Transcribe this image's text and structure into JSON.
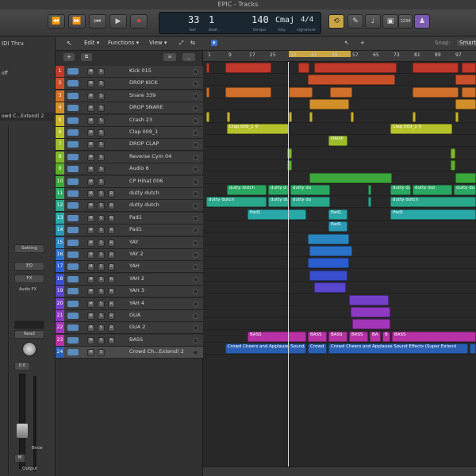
{
  "window": {
    "title": "EPIC - Tracks"
  },
  "transport": {
    "buttons": [
      "⏪",
      "⏩",
      "⏮",
      "▶",
      "⏺"
    ],
    "lcd": {
      "bar": "33",
      "beat": "1",
      "bar_label": "bar",
      "beat_label": "beat",
      "tempo": "140",
      "tempo_label": "tempo",
      "key": "Cmaj",
      "key_label": "key",
      "signature": "4/4",
      "signature_label": "signature"
    },
    "right_buttons": [
      "⟲",
      "✎",
      "♩",
      "▣",
      "1234",
      "♟"
    ]
  },
  "toolbar": {
    "edit": "Edit ▾",
    "functions": "Functions ▾",
    "view": "View ▾",
    "snap_label": "Snap:",
    "snap_value": "Smart"
  },
  "inspector": {
    "top_label": "IDI Thru",
    "rows": [
      "",
      "",
      "off",
      "",
      ""
    ],
    "region_name": "owd C...Extend)  2",
    "setting": "Setting",
    "eq": "EQ",
    "fx": "FX",
    "audio_fx": "Audio FX",
    "read": "Read",
    "volume": "0.0",
    "bnce": "Bnce",
    "m": "M",
    "output": "Output"
  },
  "ruler": {
    "marks": [
      "1",
      "9",
      "17",
      "25",
      "33",
      "41",
      "49",
      "57",
      "65",
      "73",
      "81",
      "89",
      "97"
    ]
  },
  "tracks": [
    {
      "num": "1",
      "name": "Kick 015",
      "color": "#c0392b",
      "r": ""
    },
    {
      "num": "2",
      "name": "DROP KICK",
      "color": "#c9512a",
      "r": ""
    },
    {
      "num": "3",
      "name": "Snare 339",
      "color": "#d0702a",
      "r": ""
    },
    {
      "num": "4",
      "name": "DROP SNARE",
      "color": "#d2902a",
      "r": ""
    },
    {
      "num": "5",
      "name": "Crash 23",
      "color": "#c9b52b",
      "r": ""
    },
    {
      "num": "6",
      "name": "Clap 009_1",
      "color": "#b5c22b",
      "r": ""
    },
    {
      "num": "7",
      "name": "DROP CLAP",
      "color": "#9fbd2b",
      "r": ""
    },
    {
      "num": "8",
      "name": "Reverse Cym 04",
      "color": "#7fb72b",
      "r": ""
    },
    {
      "num": "9",
      "name": "Audio 6",
      "color": "#5eb02b",
      "r": ""
    },
    {
      "num": "10",
      "name": "CP Hihat 006",
      "color": "#3aa83a",
      "r": ""
    },
    {
      "num": "11",
      "name": "dutty dutch",
      "color": "#2aa863",
      "r": "R"
    },
    {
      "num": "12",
      "name": "dutty dutch",
      "color": "#2aa88c",
      "r": "R"
    },
    {
      "num": "13",
      "name": "Pad1",
      "color": "#2aa8a8",
      "r": "R"
    },
    {
      "num": "14",
      "name": "Pad1",
      "color": "#2a9ab5",
      "r": "R"
    },
    {
      "num": "15",
      "name": "YAY",
      "color": "#2a86c0",
      "r": "R"
    },
    {
      "num": "16",
      "name": "YAY 2",
      "color": "#2a72c9",
      "r": "R"
    },
    {
      "num": "17",
      "name": "YAH",
      "color": "#2a5ecf",
      "r": "R"
    },
    {
      "num": "18",
      "name": "YAH 2",
      "color": "#3a4fd0",
      "r": "R"
    },
    {
      "num": "19",
      "name": "YAH 3",
      "color": "#5a45cf",
      "r": "R"
    },
    {
      "num": "20",
      "name": "YAH 4",
      "color": "#7540c9",
      "r": "R"
    },
    {
      "num": "21",
      "name": "GUA",
      "color": "#8d3ac2",
      "r": "R"
    },
    {
      "num": "22",
      "name": "GUA 2",
      "color": "#a236b8",
      "r": "R"
    },
    {
      "num": "23",
      "name": "BASS",
      "color": "#b832a6",
      "r": "R"
    },
    {
      "num": "24",
      "name": "Crowd Ch...Extend)  2",
      "color": "#2a5eb0",
      "r": ""
    }
  ],
  "regions": [
    {
      "lane": 0,
      "start": 4,
      "width": 3,
      "color": "#c0392b",
      "label": ""
    },
    {
      "lane": 0,
      "start": 28,
      "width": 58,
      "color": "#c0392b",
      "label": ""
    },
    {
      "lane": 0,
      "start": 120,
      "width": 14,
      "color": "#c0392b",
      "label": ""
    },
    {
      "lane": 0,
      "start": 140,
      "width": 104,
      "color": "#c0392b",
      "label": ""
    },
    {
      "lane": 0,
      "start": 264,
      "width": 58,
      "color": "#c0392b",
      "label": ""
    },
    {
      "lane": 0,
      "start": 326,
      "width": 18,
      "color": "#c0392b",
      "label": ""
    },
    {
      "lane": 1,
      "start": 132,
      "width": 110,
      "color": "#c9512a",
      "label": ""
    },
    {
      "lane": 1,
      "start": 318,
      "width": 26,
      "color": "#c9512a",
      "label": ""
    },
    {
      "lane": 2,
      "start": 4,
      "width": 3,
      "color": "#d0702a",
      "label": ""
    },
    {
      "lane": 2,
      "start": 28,
      "width": 58,
      "color": "#d0702a",
      "label": ""
    },
    {
      "lane": 2,
      "start": 108,
      "width": 30,
      "color": "#d0702a",
      "label": ""
    },
    {
      "lane": 2,
      "start": 160,
      "width": 28,
      "color": "#d0702a",
      "label": ""
    },
    {
      "lane": 2,
      "start": 264,
      "width": 58,
      "color": "#d0702a",
      "label": ""
    },
    {
      "lane": 2,
      "start": 326,
      "width": 18,
      "color": "#d0702a",
      "label": ""
    },
    {
      "lane": 3,
      "start": 134,
      "width": 50,
      "color": "#d2902a",
      "label": ""
    },
    {
      "lane": 3,
      "start": 318,
      "width": 26,
      "color": "#d2902a",
      "label": ""
    },
    {
      "lane": 4,
      "start": 4,
      "width": 3,
      "color": "#c9b52b",
      "label": ""
    },
    {
      "lane": 4,
      "start": 30,
      "width": 4,
      "color": "#c9b52b",
      "label": ""
    },
    {
      "lane": 4,
      "start": 108,
      "width": 4,
      "color": "#c9b52b",
      "label": ""
    },
    {
      "lane": 4,
      "start": 134,
      "width": 4,
      "color": "#c9b52b",
      "label": ""
    },
    {
      "lane": 4,
      "start": 186,
      "width": 4,
      "color": "#c9b52b",
      "label": ""
    },
    {
      "lane": 4,
      "start": 264,
      "width": 4,
      "color": "#c9b52b",
      "label": ""
    },
    {
      "lane": 4,
      "start": 318,
      "width": 4,
      "color": "#c9b52b",
      "label": ""
    },
    {
      "lane": 5,
      "start": 30,
      "width": 78,
      "color": "#b5c22b",
      "label": "Clap 009_1 ⚲"
    },
    {
      "lane": 5,
      "start": 236,
      "width": 78,
      "color": "#b5c22b",
      "label": "Clap 009_1 ⚲"
    },
    {
      "lane": 6,
      "start": 158,
      "width": 24,
      "color": "#9fbd2b",
      "label": "DROP"
    },
    {
      "lane": 7,
      "start": 106,
      "width": 6,
      "color": "#7fb72b",
      "label": ""
    },
    {
      "lane": 7,
      "start": 312,
      "width": 6,
      "color": "#7fb72b",
      "label": ""
    },
    {
      "lane": 8,
      "start": 106,
      "width": 6,
      "color": "#5eb02b",
      "label": ""
    },
    {
      "lane": 8,
      "start": 312,
      "width": 6,
      "color": "#5eb02b",
      "label": ""
    },
    {
      "lane": 9,
      "start": 134,
      "width": 104,
      "color": "#3aa83a",
      "label": ""
    },
    {
      "lane": 9,
      "start": 318,
      "width": 26,
      "color": "#3aa83a",
      "label": ""
    },
    {
      "lane": 10,
      "start": 30,
      "width": 50,
      "color": "#2aa863",
      "label": "dutty dutch"
    },
    {
      "lane": 10,
      "start": 82,
      "width": 26,
      "color": "#2aa863",
      "label": "dutty d"
    },
    {
      "lane": 10,
      "start": 110,
      "width": 50,
      "color": "#2aa863",
      "label": "dutty du"
    },
    {
      "lane": 10,
      "start": 208,
      "width": 4,
      "color": "#2aa863",
      "label": ""
    },
    {
      "lane": 10,
      "start": 236,
      "width": 26,
      "color": "#2aa863",
      "label": "dutty du"
    },
    {
      "lane": 10,
      "start": 264,
      "width": 50,
      "color": "#2aa863",
      "label": "dutty dut"
    },
    {
      "lane": 10,
      "start": 316,
      "width": 28,
      "color": "#2aa863",
      "label": "dutty du"
    },
    {
      "lane": 11,
      "start": 4,
      "width": 76,
      "color": "#2aa88c",
      "label": "dutty dutch"
    },
    {
      "lane": 11,
      "start": 82,
      "width": 26,
      "color": "#2aa88c",
      "label": "dutty du"
    },
    {
      "lane": 11,
      "start": 110,
      "width": 50,
      "color": "#2aa88c",
      "label": "dutty du"
    },
    {
      "lane": 11,
      "start": 208,
      "width": 4,
      "color": "#2aa88c",
      "label": ""
    },
    {
      "lane": 11,
      "start": 236,
      "width": 108,
      "color": "#2aa88c",
      "label": "dutty dutch"
    },
    {
      "lane": 12,
      "start": 56,
      "width": 74,
      "color": "#2aa8a8",
      "label": "Pad1"
    },
    {
      "lane": 12,
      "start": 158,
      "width": 24,
      "color": "#2aa8a8",
      "label": "Pad1"
    },
    {
      "lane": 12,
      "start": 236,
      "width": 108,
      "color": "#2aa8a8",
      "label": "Pad1"
    },
    {
      "lane": 13,
      "start": 158,
      "width": 24,
      "color": "#2a9ab5",
      "label": "Pad1"
    },
    {
      "lane": 14,
      "start": 132,
      "width": 52,
      "color": "#2a86c0",
      "label": ""
    },
    {
      "lane": 15,
      "start": 134,
      "width": 54,
      "color": "#2a72c9",
      "label": ""
    },
    {
      "lane": 16,
      "start": 132,
      "width": 52,
      "color": "#2a5ecf",
      "label": ""
    },
    {
      "lane": 17,
      "start": 134,
      "width": 48,
      "color": "#3a4fd0",
      "label": ""
    },
    {
      "lane": 18,
      "start": 140,
      "width": 40,
      "color": "#5a45cf",
      "label": ""
    },
    {
      "lane": 19,
      "start": 184,
      "width": 50,
      "color": "#7540c9",
      "label": ""
    },
    {
      "lane": 20,
      "start": 186,
      "width": 50,
      "color": "#8d3ac2",
      "label": ""
    },
    {
      "lane": 21,
      "start": 188,
      "width": 48,
      "color": "#a236b8",
      "label": ""
    },
    {
      "lane": 22,
      "start": 56,
      "width": 74,
      "color": "#b832a6",
      "label": "BASS"
    },
    {
      "lane": 22,
      "start": 132,
      "width": 24,
      "color": "#b832a6",
      "label": "BASS"
    },
    {
      "lane": 22,
      "start": 158,
      "width": 24,
      "color": "#b832a6",
      "label": "BASS"
    },
    {
      "lane": 22,
      "start": 184,
      "width": 24,
      "color": "#b832a6",
      "label": "BASS"
    },
    {
      "lane": 22,
      "start": 210,
      "width": 14,
      "color": "#b832a6",
      "label": "BA"
    },
    {
      "lane": 22,
      "start": 226,
      "width": 10,
      "color": "#b832a6",
      "label": "B"
    },
    {
      "lane": 22,
      "start": 238,
      "width": 106,
      "color": "#b832a6",
      "label": "BASS"
    },
    {
      "lane": 23,
      "start": 28,
      "width": 102,
      "color": "#2a5eb0",
      "label": "Crowd Cheers and Applause Sound"
    },
    {
      "lane": 23,
      "start": 132,
      "width": 24,
      "color": "#2a5eb0",
      "label": "Crowd"
    },
    {
      "lane": 23,
      "start": 158,
      "width": 176,
      "color": "#2a5eb0",
      "label": "Crowd Cheers and Applause Sound Effects (Super Extend"
    },
    {
      "lane": 23,
      "start": 336,
      "width": 8,
      "color": "#2a5eb0",
      "label": ""
    }
  ]
}
